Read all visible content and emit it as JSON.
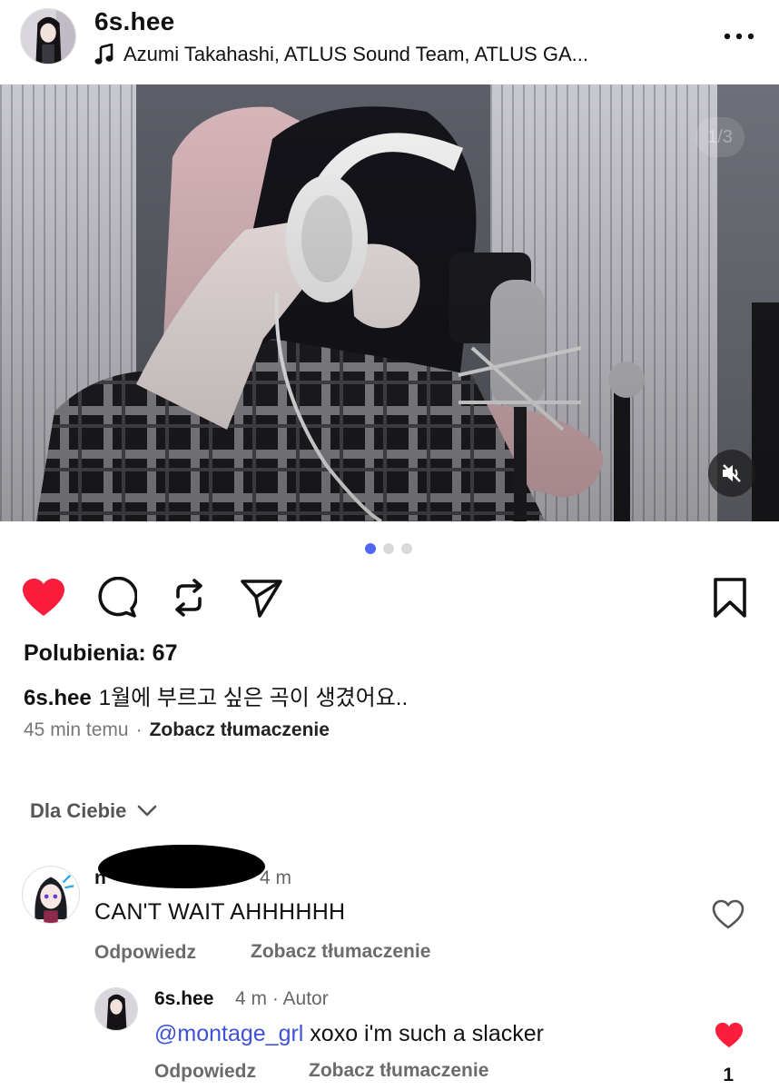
{
  "header": {
    "username": "6s.hee",
    "music": "Azumi Takahashi, ATLUS Sound Team, ATLUS GA...",
    "more_icon": "more-horizontal-icon"
  },
  "media": {
    "counter": "1/3",
    "mute_icon": "volume-muted-icon"
  },
  "carousel": {
    "total": 3,
    "active": 1,
    "active_color": "#4f66f0"
  },
  "actions": {
    "like_icon": "heart-filled-icon",
    "like_color": "#fb1e3c",
    "comment_icon": "comment-icon",
    "repost_icon": "repost-icon",
    "share_icon": "send-icon",
    "save_icon": "bookmark-icon"
  },
  "post": {
    "likes": "Polubienia: 67",
    "caption_user": "6s.hee",
    "caption": "1월에 부르고 싶은 곡이 생겼어요..",
    "time": "45 min temu",
    "separator": "·",
    "translate": "Zobacz tłumaczenie"
  },
  "filter": {
    "label": "Dla Ciebie",
    "icon": "chevron-down-icon"
  },
  "comments": [
    {
      "user": "n",
      "time": "4 m",
      "text": "CAN'T WAIT AHHHHHH",
      "reply": "Odpowiedz",
      "translate": "Zobacz tłumaczenie",
      "liked": false
    },
    {
      "user": "6s.hee",
      "time": "4 m · Autor",
      "mention": "@montage_grl",
      "text": " xoxo i'm such a slacker",
      "reply": "Odpowiedz",
      "translate": "Zobacz tłumaczenie",
      "liked": true,
      "like_count": "1"
    }
  ]
}
